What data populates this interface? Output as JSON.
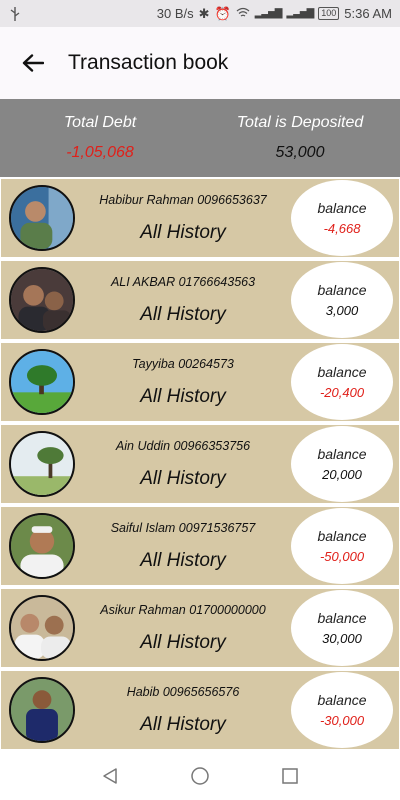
{
  "status_bar": {
    "left_icon": "usb-icon",
    "speed": "30 B/s",
    "battery": "100",
    "time": "5:36 AM"
  },
  "app_bar": {
    "back_icon": "arrow-left-icon",
    "title": "Transaction book"
  },
  "summary": {
    "debt_label": "Total Debt",
    "debt_value": "-1,05,068",
    "deposit_label": "Total is Deposited",
    "deposit_value": "53,000"
  },
  "contacts": [
    {
      "name": "Habibur Rahman 0096653637",
      "history": "All History",
      "balance_label": "balance",
      "balance": "-4,668",
      "negative": true
    },
    {
      "name": "ALI AKBAR 01766643563",
      "history": "All History",
      "balance_label": "balance",
      "balance": "3,000",
      "negative": false
    },
    {
      "name": "Tayyiba 00264573",
      "history": "All History",
      "balance_label": "balance",
      "balance": "-20,400",
      "negative": true
    },
    {
      "name": "Ain Uddin 00966353756",
      "history": "All History",
      "balance_label": "balance",
      "balance": "20,000",
      "negative": false
    },
    {
      "name": "Saiful Islam 00971536757",
      "history": "All History",
      "balance_label": "balance",
      "balance": "-50,000",
      "negative": true
    },
    {
      "name": "Asikur Rahman 01700000000",
      "history": "All History",
      "balance_label": "balance",
      "balance": "30,000",
      "negative": false
    },
    {
      "name": "Habib 00965656576",
      "history": "All History",
      "balance_label": "balance",
      "balance": "-30,000",
      "negative": true
    }
  ],
  "colors": {
    "row_background": "#d6c8a5",
    "summary_background": "#868686",
    "negative": "#e0201a"
  },
  "nav_bar": {
    "back_icon": "triangle-back-icon",
    "home_icon": "circle-home-icon",
    "recents_icon": "square-recents-icon"
  }
}
